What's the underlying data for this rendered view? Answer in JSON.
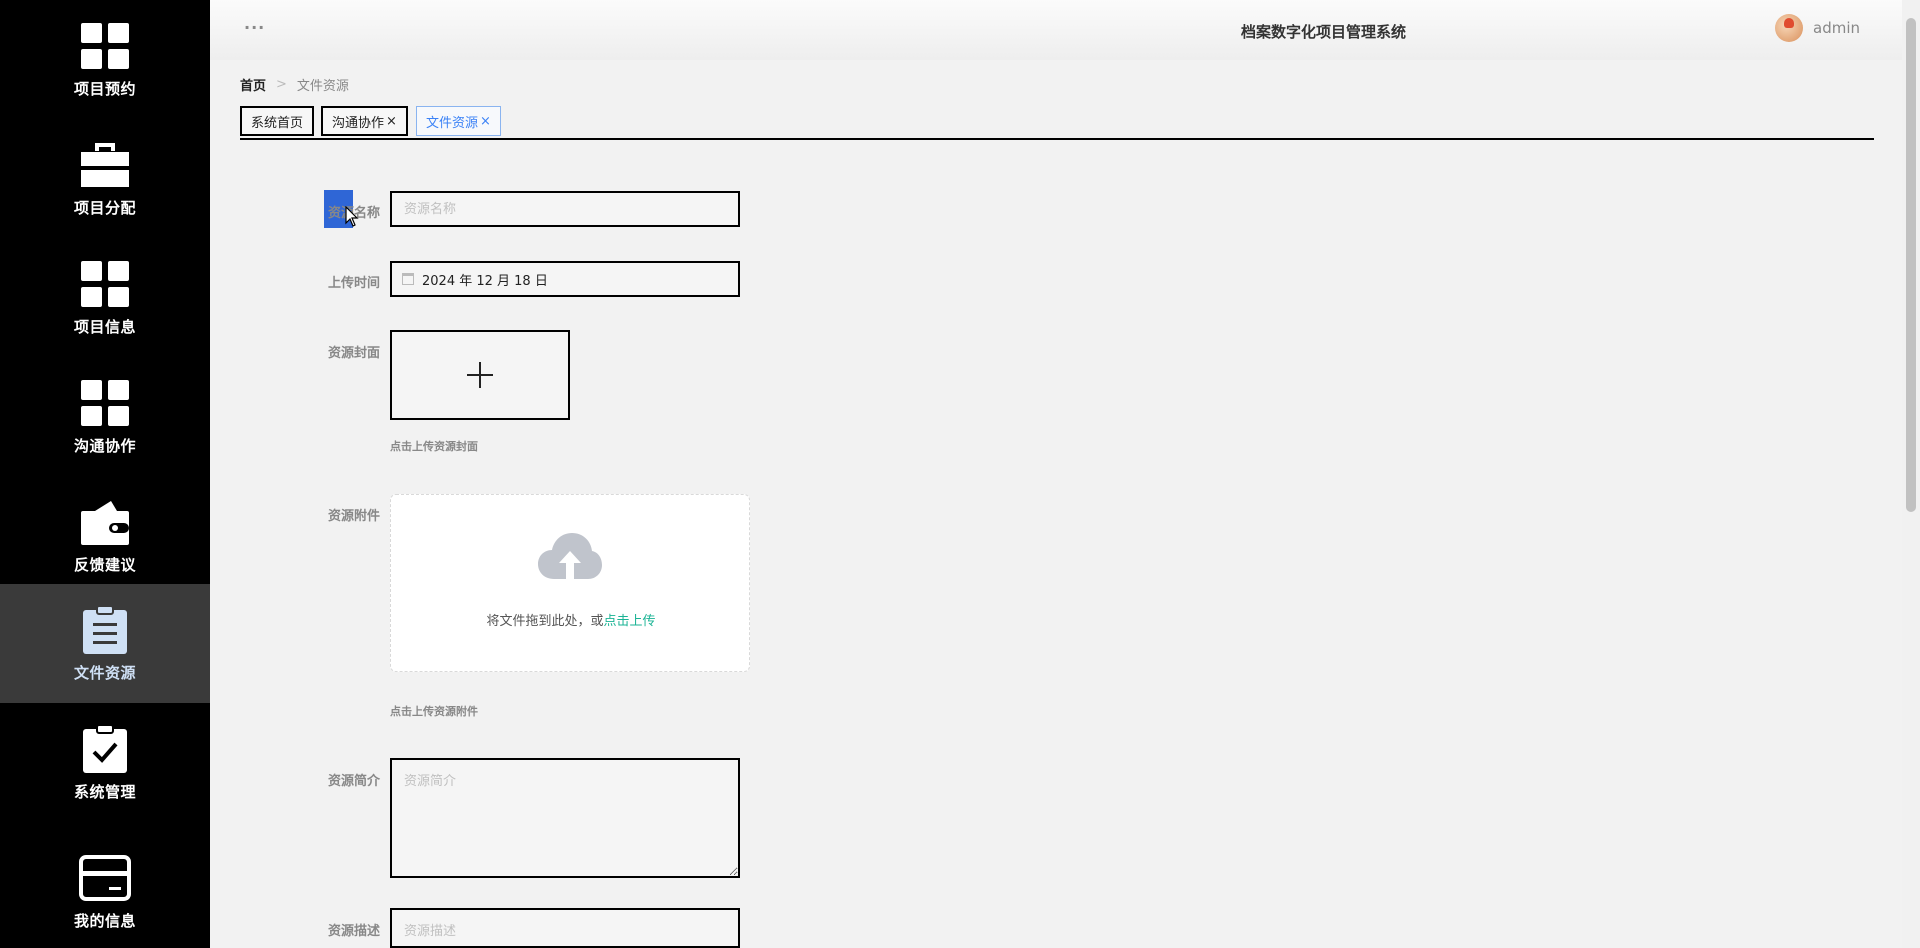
{
  "app": {
    "title": "档案数字化项目管理系统",
    "menu_dots": "···",
    "username": "admin"
  },
  "sidebar": {
    "items": [
      {
        "label": "项目预约",
        "icon": "grid-icon"
      },
      {
        "label": "项目分配",
        "icon": "briefcase-icon"
      },
      {
        "label": "项目信息",
        "icon": "grid-icon"
      },
      {
        "label": "沟通协作",
        "icon": "grid-icon"
      },
      {
        "label": "反馈建议",
        "icon": "wallet-icon"
      },
      {
        "label": "文件资源",
        "icon": "clipboard-icon",
        "active": true
      },
      {
        "label": "系统管理",
        "icon": "clipboard-check-icon"
      },
      {
        "label": "我的信息",
        "icon": "card-icon"
      }
    ]
  },
  "breadcrumb": {
    "home": "首页",
    "separator": ">",
    "current": "文件资源"
  },
  "tabs": [
    {
      "label": "系统首页",
      "closable": false
    },
    {
      "label": "沟通协作",
      "closable": true
    },
    {
      "label": "文件资源",
      "closable": true,
      "active": true
    }
  ],
  "tab_close": "×",
  "form": {
    "name": {
      "label": "资源名称",
      "placeholder": "资源名称",
      "value": ""
    },
    "upload_time": {
      "label": "上传时间",
      "value": "2024 年 12 月 18 日"
    },
    "cover": {
      "label": "资源封面",
      "hint": "点击上传资源封面"
    },
    "attachment": {
      "label": "资源附件",
      "drop_text": "将文件拖到此处，或",
      "drop_link": "点击上传",
      "hint": "点击上传资源附件"
    },
    "intro": {
      "label": "资源简介",
      "placeholder": "资源简介"
    },
    "description": {
      "label": "资源描述",
      "placeholder": "资源描述"
    }
  },
  "colors": {
    "sidebar_bg": "#000000",
    "sidebar_active": "#3a3a3a",
    "accent_link": "#1ab394",
    "active_tab": "#3b82f6"
  }
}
